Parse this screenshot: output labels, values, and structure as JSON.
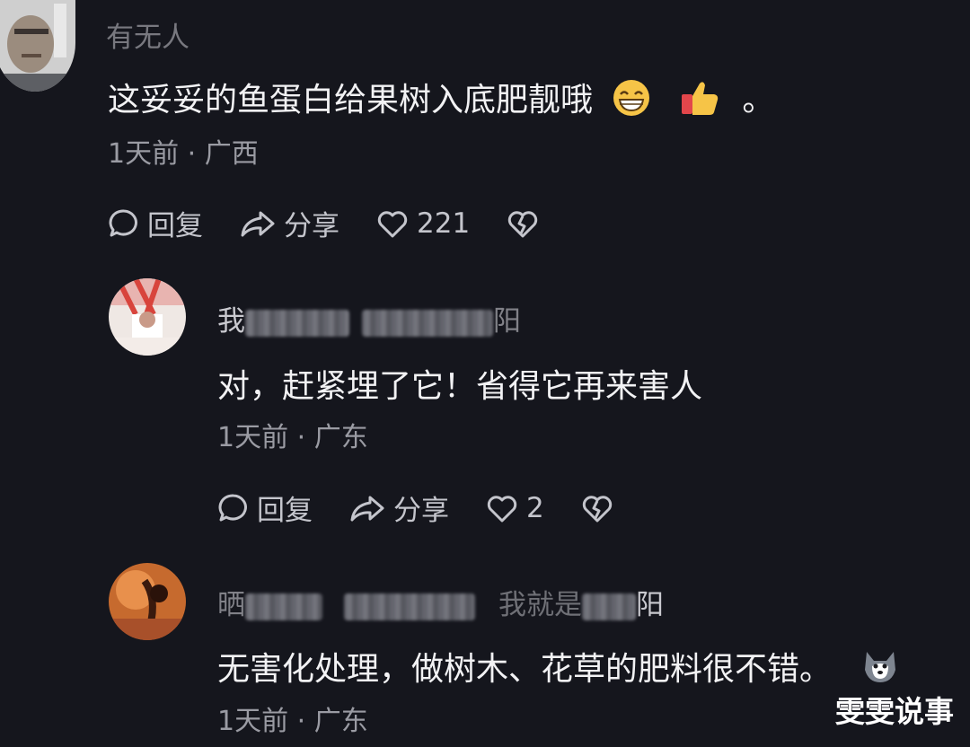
{
  "comments": [
    {
      "username": "有无人",
      "text": "这妥妥的鱼蛋白给果树入底肥靓哦",
      "text_suffix": "。",
      "meta": "1天前 · 广西",
      "reply_label": "回复",
      "share_label": "分享",
      "like_count": "221"
    },
    {
      "username_start": "我",
      "username_end": "阳",
      "text": "对，赶紧埋了它！省得它再来害人",
      "meta": "1天前 · 广东",
      "reply_label": "回复",
      "share_label": "分享",
      "like_count": "2"
    },
    {
      "username_start": "晒",
      "username_mid": "我就是",
      "username_end": "阳",
      "text": "无害化处理，做树木、花草的肥料很不错。",
      "meta": "1天前 · 广东"
    }
  ],
  "watermark": "雯雯说事",
  "icons": [
    "comment-bubble-icon",
    "share-arrow-icon",
    "heart-icon",
    "broken-heart-icon",
    "grin-emoji-icon",
    "thumbs-up-emoji-icon",
    "husky-emoji-icon"
  ]
}
